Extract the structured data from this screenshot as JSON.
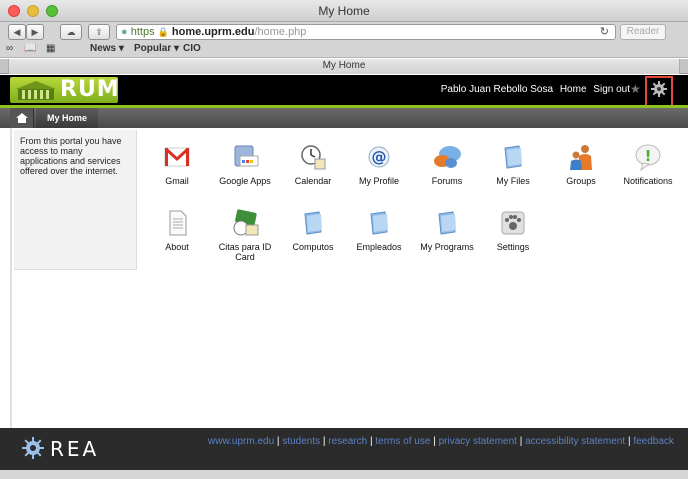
{
  "window": {
    "title": "My Home"
  },
  "browser": {
    "url_scheme": "https",
    "url_host": "home.uprm.edu",
    "url_path": "/home.php",
    "reader_label": "Reader",
    "bookmarks": [
      {
        "label": "News ▾"
      },
      {
        "label": "Popular ▾"
      },
      {
        "label": "CIO"
      }
    ],
    "tab_label": "My Home"
  },
  "header": {
    "logo_text": "RUM",
    "user_name": "Pablo Juan Rebollo Sosa",
    "home_link": "Home",
    "signout_link": "Sign out"
  },
  "nav": {
    "tab_label": "My Home"
  },
  "sidebar": {
    "text": "From this portal you have access to many applications and services offered over the internet."
  },
  "apps": [
    {
      "label": "Gmail",
      "icon": "gmail-icon"
    },
    {
      "label": "Google Apps",
      "icon": "google-apps-icon"
    },
    {
      "label": "Calendar",
      "icon": "calendar-icon"
    },
    {
      "label": "My Profile",
      "icon": "at-sign-icon"
    },
    {
      "label": "Forums",
      "icon": "forums-bubble-icon"
    },
    {
      "label": "My Files",
      "icon": "folder-icon"
    },
    {
      "label": "Groups",
      "icon": "people-icon"
    },
    {
      "label": "Notifications",
      "icon": "exclamation-bubble-icon"
    },
    {
      "label": "About",
      "icon": "document-icon"
    },
    {
      "label": "Citas para ID Card",
      "icon": "id-card-icon"
    },
    {
      "label": "Computos",
      "icon": "folder-icon"
    },
    {
      "label": "Empleados",
      "icon": "folder-icon"
    },
    {
      "label": "My Programs",
      "icon": "folder-icon"
    },
    {
      "label": "Settings",
      "icon": "paw-settings-icon"
    }
  ],
  "footer": {
    "logo_text": "REA",
    "links": [
      "www.uprm.edu",
      "students",
      "research",
      "terms of use",
      "privacy statement",
      "accessibility statement",
      "feedback"
    ]
  },
  "colors": {
    "accent_green": "#8fc21f",
    "link_blue": "#5b82c4",
    "highlight_red": "#e8473a"
  }
}
